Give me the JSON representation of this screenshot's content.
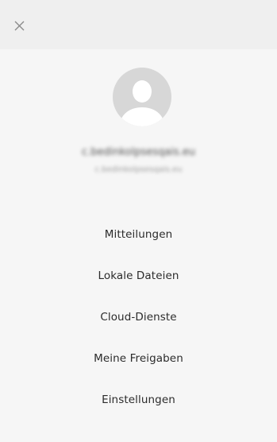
{
  "header": {
    "close_icon": "close-icon"
  },
  "profile": {
    "avatar_icon": "user-avatar-icon",
    "name": "c.bedinkolpsesqais.eu",
    "email": "c.bedinkolpsesqais.eu"
  },
  "menu": {
    "items": [
      {
        "label": "Mitteilungen"
      },
      {
        "label": "Lokale Dateien"
      },
      {
        "label": "Cloud-Dienste"
      },
      {
        "label": "Meine Freigaben"
      },
      {
        "label": "Einstellungen"
      }
    ]
  },
  "colors": {
    "panel_background": "#f6f6f6",
    "header_background": "#efefef",
    "avatar_background": "#d7d7d7",
    "text": "#2b2b2b"
  }
}
